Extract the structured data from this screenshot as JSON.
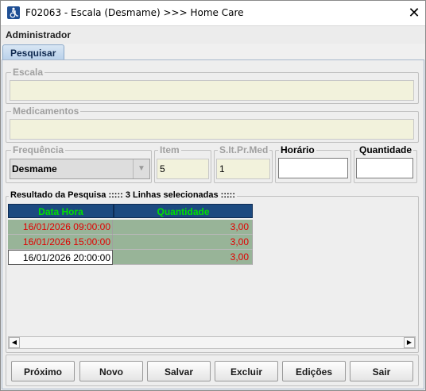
{
  "window": {
    "title": "F02063 - Escala (Desmame) >>> Home Care",
    "user": "Administrador"
  },
  "tabs": [
    {
      "label": "Pesquisar"
    }
  ],
  "form": {
    "escala": {
      "label": "Escala",
      "value": ""
    },
    "medicamentos": {
      "label": "Medicamentos",
      "value": ""
    },
    "frequencia": {
      "label": "Frequência",
      "value": "Desmame"
    },
    "item": {
      "label": "Item",
      "value": "5"
    },
    "slt": {
      "label": "S.It.Pr.Med",
      "value": "1"
    },
    "horario": {
      "label": "Horário",
      "value": ""
    },
    "quantidade": {
      "label": "Quantidade",
      "value": ""
    }
  },
  "results": {
    "caption": "Resultado da Pesquisa ::::: 3 Linhas selecionadas :::::",
    "columns": [
      "Data Hora",
      "Quantidade"
    ],
    "rows": [
      {
        "datahora": "16/01/2026 09:00:00",
        "quantidade": "3,00"
      },
      {
        "datahora": "16/01/2026 15:00:00",
        "quantidade": "3,00"
      },
      {
        "datahora": "16/01/2026 20:00:00",
        "quantidade": "3,00"
      }
    ]
  },
  "buttons": [
    "Próximo",
    "Novo",
    "Salvar",
    "Excluir",
    "Edições",
    "Sair"
  ],
  "colors": {
    "header_bg": "#1c4a80",
    "header_text": "#00e000",
    "row_red": "#e00000",
    "qty_bg": "#98b498",
    "field_bg": "#f2f2dc"
  },
  "icons": {
    "app": "accessibility-icon",
    "close": "close-icon",
    "combo": "chevron-down-icon",
    "scroll_left": "triangle-left-icon",
    "scroll_right": "triangle-right-icon"
  }
}
